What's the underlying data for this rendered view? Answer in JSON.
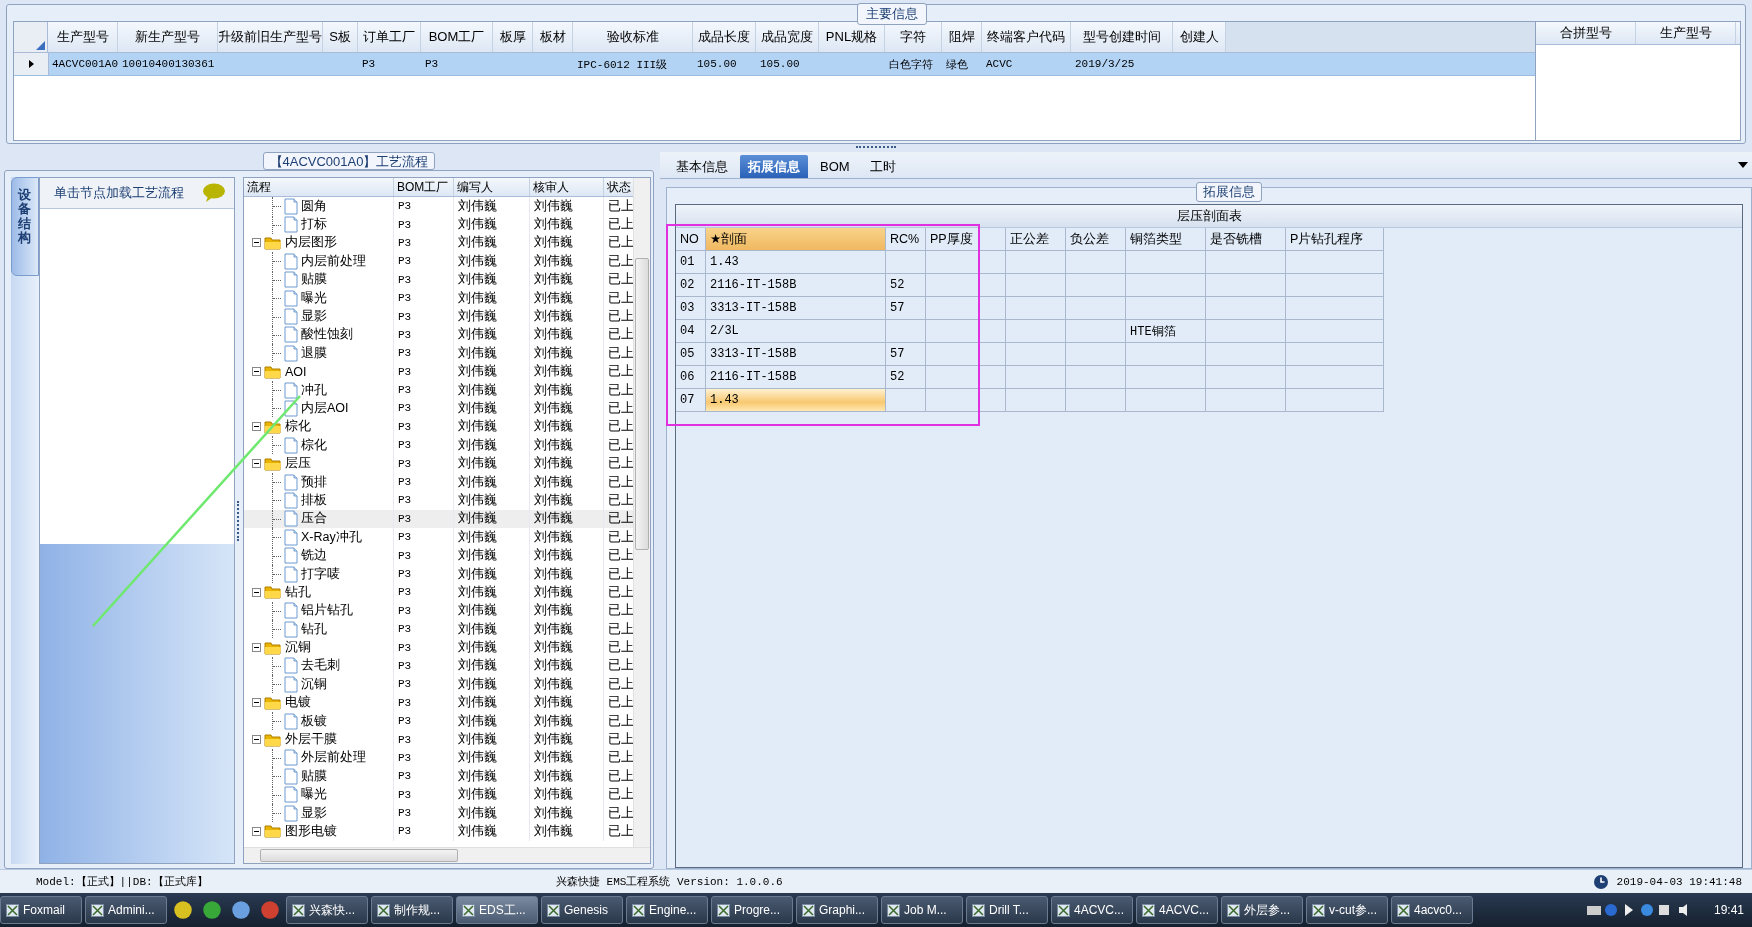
{
  "main_info": {
    "legend": "主要信息",
    "columns": [
      "生产型号",
      "新生产型号",
      "升级前旧生产型号",
      "S板",
      "订单工厂",
      "BOM工厂",
      "板厚",
      "板材",
      "验收标准",
      "成品长度",
      "成品宽度",
      "PNL规格",
      "字符",
      "阻焊",
      "终端客户代码",
      "型号创建时间",
      "创建人"
    ],
    "rows": [
      {
        "selected": true,
        "cells": [
          "4ACVC001A0",
          "10010400130361",
          null,
          null,
          "P3",
          "P3",
          null,
          null,
          "IPC-6012 III级",
          "105.00",
          "105.00",
          null,
          "白色字符",
          "绿色",
          "ACVC",
          "2019/3/25",
          null
        ]
      }
    ]
  },
  "merge_table": {
    "columns": [
      "合拼型号",
      "生产型号"
    ]
  },
  "process": {
    "title": "【4ACVC001A0】工艺流程",
    "side_tab": "设备结构",
    "hint": "单击节点加载工艺流程",
    "columns": [
      "流程",
      "BOM工厂",
      "编写人",
      "核审人",
      "状态"
    ],
    "nodes": [
      {
        "kind": "hidden",
        "children": [
          {
            "kind": "file",
            "label": "圆角",
            "bom": "P3",
            "writer": "刘伟巍",
            "reviewer": "刘伟巍",
            "status": "已上",
            "selected": false
          },
          {
            "kind": "file",
            "label": "打标",
            "bom": "P3",
            "writer": "刘伟巍",
            "reviewer": "刘伟巍",
            "status": "已上",
            "selected": false
          }
        ]
      },
      {
        "kind": "folder",
        "label": "内层图形",
        "bom": "P3",
        "writer": "刘伟巍",
        "reviewer": "刘伟巍",
        "status": "已上",
        "selected": false,
        "children": [
          {
            "kind": "file",
            "label": "内层前处理",
            "bom": "P3",
            "writer": "刘伟巍",
            "reviewer": "刘伟巍",
            "status": "已上",
            "selected": false
          },
          {
            "kind": "file",
            "label": "贴膜",
            "bom": "P3",
            "writer": "刘伟巍",
            "reviewer": "刘伟巍",
            "status": "已上",
            "selected": false
          },
          {
            "kind": "file",
            "label": "曝光",
            "bom": "P3",
            "writer": "刘伟巍",
            "reviewer": "刘伟巍",
            "status": "已上",
            "selected": false
          },
          {
            "kind": "file",
            "label": "显影",
            "bom": "P3",
            "writer": "刘伟巍",
            "reviewer": "刘伟巍",
            "status": "已上",
            "selected": false
          },
          {
            "kind": "file",
            "label": "酸性蚀刻",
            "bom": "P3",
            "writer": "刘伟巍",
            "reviewer": "刘伟巍",
            "status": "已上",
            "selected": false
          },
          {
            "kind": "file",
            "label": "退膜",
            "bom": "P3",
            "writer": "刘伟巍",
            "reviewer": "刘伟巍",
            "status": "已上",
            "selected": false
          }
        ]
      },
      {
        "kind": "folder",
        "label": "AOI",
        "bom": "P3",
        "writer": "刘伟巍",
        "reviewer": "刘伟巍",
        "status": "已上",
        "selected": false,
        "children": [
          {
            "kind": "file",
            "label": "冲孔",
            "bom": "P3",
            "writer": "刘伟巍",
            "reviewer": "刘伟巍",
            "status": "已上",
            "selected": false
          },
          {
            "kind": "file",
            "label": "内层AOI",
            "bom": "P3",
            "writer": "刘伟巍",
            "reviewer": "刘伟巍",
            "status": "已上",
            "selected": false
          }
        ]
      },
      {
        "kind": "folder",
        "label": "棕化",
        "bom": "P3",
        "writer": "刘伟巍",
        "reviewer": "刘伟巍",
        "status": "已上",
        "selected": false,
        "children": [
          {
            "kind": "file",
            "label": "棕化",
            "bom": "P3",
            "writer": "刘伟巍",
            "reviewer": "刘伟巍",
            "status": "已上",
            "selected": false
          }
        ]
      },
      {
        "kind": "folder",
        "label": "层压",
        "bom": "P3",
        "writer": "刘伟巍",
        "reviewer": "刘伟巍",
        "status": "已上",
        "selected": false,
        "children": [
          {
            "kind": "file",
            "label": "预排",
            "bom": "P3",
            "writer": "刘伟巍",
            "reviewer": "刘伟巍",
            "status": "已上",
            "selected": false
          },
          {
            "kind": "file",
            "label": "排板",
            "bom": "P3",
            "writer": "刘伟巍",
            "reviewer": "刘伟巍",
            "status": "已上",
            "selected": false
          },
          {
            "kind": "file",
            "label": "压合",
            "bom": "P3",
            "writer": "刘伟巍",
            "reviewer": "刘伟巍",
            "status": "已上",
            "selected": true
          },
          {
            "kind": "file",
            "label": "X-Ray冲孔",
            "bom": "P3",
            "writer": "刘伟巍",
            "reviewer": "刘伟巍",
            "status": "已上",
            "selected": false
          },
          {
            "kind": "file",
            "label": "铣边",
            "bom": "P3",
            "writer": "刘伟巍",
            "reviewer": "刘伟巍",
            "status": "已上",
            "selected": false
          },
          {
            "kind": "file",
            "label": "打字唛",
            "bom": "P3",
            "writer": "刘伟巍",
            "reviewer": "刘伟巍",
            "status": "已上",
            "selected": false
          }
        ]
      },
      {
        "kind": "folder",
        "label": "钻孔",
        "bom": "P3",
        "writer": "刘伟巍",
        "reviewer": "刘伟巍",
        "status": "已上",
        "selected": false,
        "children": [
          {
            "kind": "file",
            "label": "铝片钻孔",
            "bom": "P3",
            "writer": "刘伟巍",
            "reviewer": "刘伟巍",
            "status": "已上",
            "selected": false
          },
          {
            "kind": "file",
            "label": "钻孔",
            "bom": "P3",
            "writer": "刘伟巍",
            "reviewer": "刘伟巍",
            "status": "已上",
            "selected": false
          }
        ]
      },
      {
        "kind": "folder",
        "label": "沉铜",
        "bom": "P3",
        "writer": "刘伟巍",
        "reviewer": "刘伟巍",
        "status": "已上",
        "selected": false,
        "children": [
          {
            "kind": "file",
            "label": "去毛刺",
            "bom": "P3",
            "writer": "刘伟巍",
            "reviewer": "刘伟巍",
            "status": "已上",
            "selected": false
          },
          {
            "kind": "file",
            "label": "沉铜",
            "bom": "P3",
            "writer": "刘伟巍",
            "reviewer": "刘伟巍",
            "status": "已上",
            "selected": false
          }
        ]
      },
      {
        "kind": "folder",
        "label": "电镀",
        "bom": "P3",
        "writer": "刘伟巍",
        "reviewer": "刘伟巍",
        "status": "已上",
        "selected": false,
        "children": [
          {
            "kind": "file",
            "label": "板镀",
            "bom": "P3",
            "writer": "刘伟巍",
            "reviewer": "刘伟巍",
            "status": "已上",
            "selected": false
          }
        ]
      },
      {
        "kind": "folder",
        "label": "外层干膜",
        "bom": "P3",
        "writer": "刘伟巍",
        "reviewer": "刘伟巍",
        "status": "已上",
        "selected": false,
        "children": [
          {
            "kind": "file",
            "label": "外层前处理",
            "bom": "P3",
            "writer": "刘伟巍",
            "reviewer": "刘伟巍",
            "status": "已上",
            "selected": false
          },
          {
            "kind": "file",
            "label": "贴膜",
            "bom": "P3",
            "writer": "刘伟巍",
            "reviewer": "刘伟巍",
            "status": "已上",
            "selected": false
          },
          {
            "kind": "file",
            "label": "曝光",
            "bom": "P3",
            "writer": "刘伟巍",
            "reviewer": "刘伟巍",
            "status": "已上",
            "selected": false
          },
          {
            "kind": "file",
            "label": "显影",
            "bom": "P3",
            "writer": "刘伟巍",
            "reviewer": "刘伟巍",
            "status": "已上",
            "selected": false
          }
        ]
      },
      {
        "kind": "folder",
        "label": "图形电镀",
        "bom": "P3",
        "writer": "刘伟巍",
        "reviewer": "刘伟巍",
        "status": "已上",
        "selected": false
      }
    ]
  },
  "detail": {
    "tabs": [
      {
        "label": "基本信息",
        "selected": false
      },
      {
        "label": "拓展信息",
        "selected": true
      },
      {
        "label": "BOM",
        "selected": false
      },
      {
        "label": "工时",
        "selected": false
      }
    ],
    "legend": "拓展信息",
    "table": {
      "title": "层压剖面表",
      "columns": [
        {
          "label": "NO",
          "highlighted": false
        },
        {
          "label": "★剖面",
          "highlighted": true
        },
        {
          "label": "RC%",
          "highlighted": false
        },
        {
          "label": "PP厚度",
          "highlighted": false
        },
        {
          "label": "正公差",
          "highlighted": false
        },
        {
          "label": "负公差",
          "highlighted": false
        },
        {
          "label": "铜箔类型",
          "highlighted": false
        },
        {
          "label": "是否铣槽",
          "highlighted": false
        },
        {
          "label": "P片钻孔程序",
          "highlighted": false
        }
      ],
      "rows": [
        {
          "selected": false,
          "cells": [
            "01",
            "1.43",
            null,
            null,
            null,
            null,
            null,
            null,
            null
          ]
        },
        {
          "selected": false,
          "cells": [
            "02",
            "2116-IT-158B",
            "52",
            null,
            null,
            null,
            null,
            null,
            null
          ]
        },
        {
          "selected": false,
          "cells": [
            "03",
            "3313-IT-158B",
            "57",
            null,
            null,
            null,
            null,
            null,
            null
          ]
        },
        {
          "selected": false,
          "cells": [
            "04",
            "2/3L",
            null,
            null,
            null,
            null,
            "HTE铜箔",
            null,
            null
          ]
        },
        {
          "selected": false,
          "cells": [
            "05",
            "3313-IT-158B",
            "57",
            null,
            null,
            null,
            null,
            null,
            null
          ]
        },
        {
          "selected": false,
          "cells": [
            "06",
            "2116-IT-158B",
            "52",
            null,
            null,
            null,
            null,
            null,
            null
          ]
        },
        {
          "selected": true,
          "cells": [
            "07",
            "1.43",
            null,
            null,
            null,
            null,
            null,
            null,
            null
          ]
        }
      ]
    }
  },
  "status_bar": {
    "left": "Model:【正式】||DB:【正式库】",
    "center": "兴森快捷 EMS工程系统 Version: 1.0.0.6",
    "time": "2019-04-03 19:41:48"
  },
  "taskbar": {
    "items": [
      {
        "kind": "app",
        "label": "Foxmail",
        "selected": false
      },
      {
        "kind": "app",
        "label": "Admini...",
        "selected": false
      },
      {
        "kind": "icon"
      },
      {
        "kind": "icon"
      },
      {
        "kind": "icon"
      },
      {
        "kind": "icon"
      },
      {
        "kind": "app",
        "label": "兴森快...",
        "selected": false
      },
      {
        "kind": "app",
        "label": "制作规...",
        "selected": false
      },
      {
        "kind": "app",
        "label": "EDS工...",
        "selected": true
      },
      {
        "kind": "app",
        "label": "Genesis",
        "selected": false
      },
      {
        "kind": "app",
        "label": "Engine...",
        "selected": false
      },
      {
        "kind": "app",
        "label": "Progre...",
        "selected": false
      },
      {
        "kind": "app",
        "label": "Graphi...",
        "selected": false
      },
      {
        "kind": "app",
        "label": "Job M...",
        "selected": false
      },
      {
        "kind": "app",
        "label": "Drill T...",
        "selected": false
      },
      {
        "kind": "app",
        "label": "4ACVC...",
        "selected": false
      },
      {
        "kind": "app",
        "label": "4ACVC...",
        "selected": false
      },
      {
        "kind": "app",
        "label": "外层参...",
        "selected": false
      },
      {
        "kind": "app",
        "label": "v-cut参...",
        "selected": false
      },
      {
        "kind": "app",
        "label": "4acvc0...",
        "selected": false
      }
    ],
    "clock": "19:41"
  }
}
